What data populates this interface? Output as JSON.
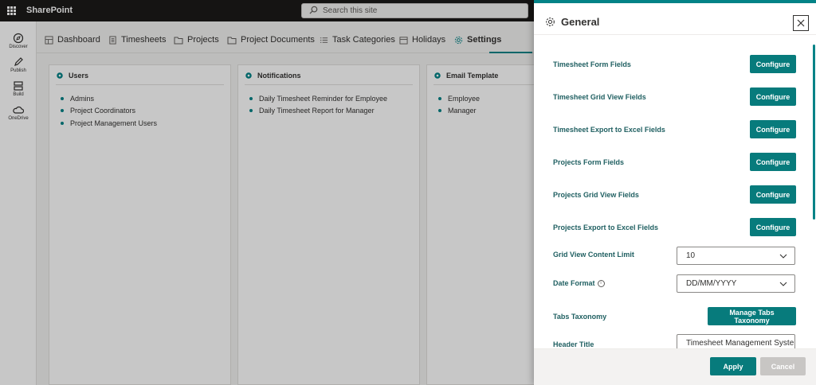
{
  "app": {
    "title": "SharePoint"
  },
  "search": {
    "placeholder": "Search this site"
  },
  "rail": [
    {
      "label": "Discover",
      "icon": "discover-icon"
    },
    {
      "label": "Publish",
      "icon": "publish-icon"
    },
    {
      "label": "Build",
      "icon": "build-icon"
    },
    {
      "label": "OneDrive",
      "icon": "onedrive-icon"
    }
  ],
  "nav": [
    {
      "label": "Dashboard",
      "icon": "dashboard-icon"
    },
    {
      "label": "Timesheets",
      "icon": "timesheets-icon"
    },
    {
      "label": "Projects",
      "icon": "folder-icon"
    },
    {
      "label": "Project Documents",
      "icon": "folder-icon"
    },
    {
      "label": "Task Categories",
      "icon": "list-icon"
    },
    {
      "label": "Holidays",
      "icon": "calendar-icon"
    },
    {
      "label": "Settings",
      "icon": "gear-icon",
      "active": true
    }
  ],
  "cards": [
    {
      "title": "Users",
      "items": [
        "Admins",
        "Project Coordinators",
        "Project Management Users"
      ]
    },
    {
      "title": "Notifications",
      "items": [
        "Daily Timesheet Reminder for Employee",
        "Daily Timesheet Report for Manager"
      ]
    },
    {
      "title": "Email Template",
      "items": [
        "Employee",
        "Manager"
      ]
    }
  ],
  "panel": {
    "title": "General",
    "rows": [
      {
        "label": "Timesheet Form Fields",
        "button": "Configure"
      },
      {
        "label": "Timesheet Grid View Fields",
        "button": "Configure"
      },
      {
        "label": "Timesheet Export to Excel Fields",
        "button": "Configure"
      },
      {
        "label": "Projects Form Fields",
        "button": "Configure"
      },
      {
        "label": "Projects Grid View Fields",
        "button": "Configure"
      },
      {
        "label": "Projects Export to Excel Fields",
        "button": "Configure"
      }
    ],
    "grid_limit": {
      "label": "Grid View Content Limit",
      "value": "10"
    },
    "date_format": {
      "label": "Date Format",
      "value": "DD/MM/YYYY"
    },
    "tabs_taxonomy": {
      "label": "Tabs Taxonomy",
      "button": "Manage Tabs Taxonomy"
    },
    "header_title": {
      "label": "Header Title",
      "value": "Timesheet Management Syste"
    },
    "apply": "Apply",
    "cancel": "Cancel"
  },
  "colors": {
    "accent": "#038387",
    "button": "#077b7c",
    "label": "#1f5f61",
    "topbar": "#1b1a19"
  }
}
